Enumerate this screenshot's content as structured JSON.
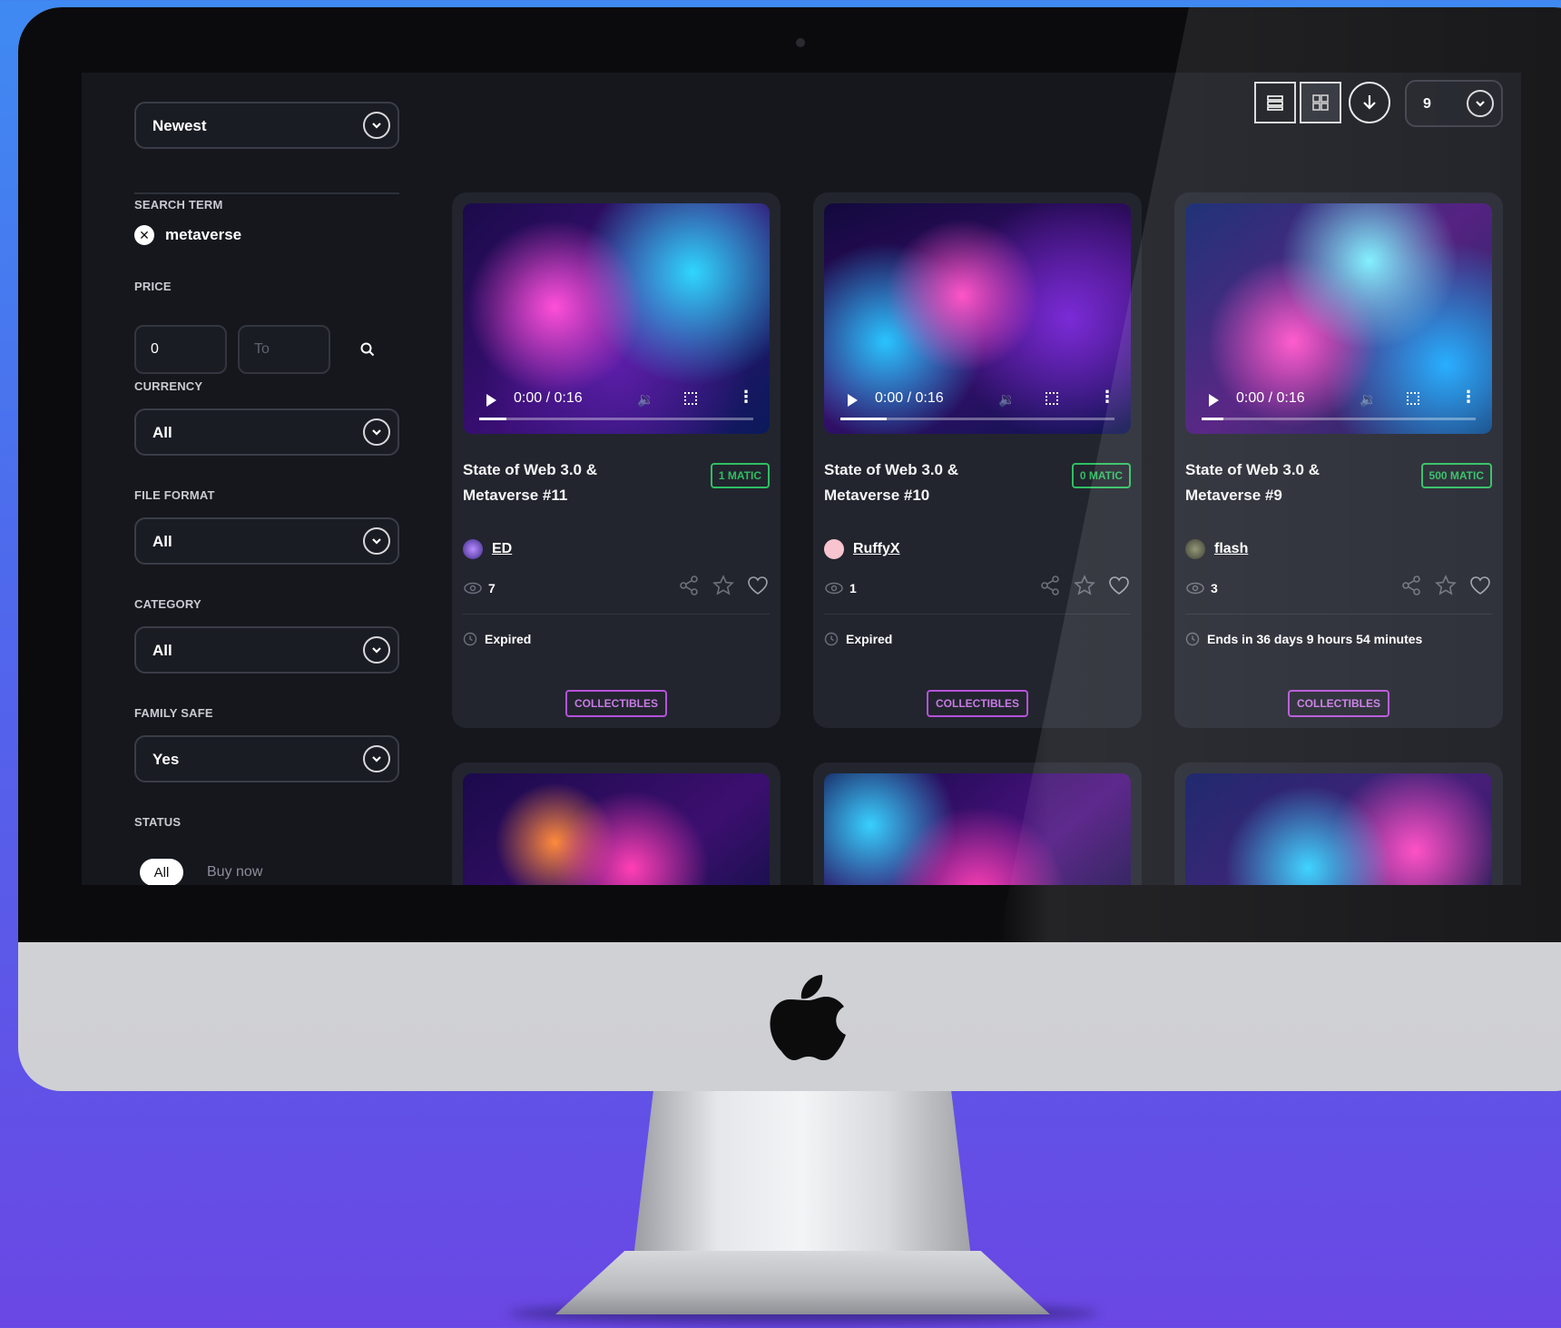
{
  "sort": {
    "value": "Newest"
  },
  "filters": {
    "search_term_label": "SEARCH TERM",
    "search_term": "metaverse",
    "price_label": "PRICE",
    "price_from": "0",
    "price_to_placeholder": "To",
    "currency_label": "CURRENCY",
    "currency_value": "All",
    "file_format_label": "FILE FORMAT",
    "file_format_value": "All",
    "category_label": "CATEGORY",
    "category_value": "All",
    "family_safe_label": "FAMILY SAFE",
    "family_safe_value": "Yes",
    "status_label": "STATUS",
    "status_options": [
      "All",
      "Buy now"
    ],
    "status_selected": "All"
  },
  "toolbar": {
    "per_page": "9"
  },
  "cards": [
    {
      "title": "State of Web 3.0 & Metaverse #11",
      "price": "1 MATIC",
      "creator": "ED",
      "views": "7",
      "time": "0:00 / 0:16",
      "progress": 0.1,
      "status": "Expired",
      "category": "COLLECTIBLES"
    },
    {
      "title": "State of Web 3.0 & Metaverse #10",
      "price": "0 MATIC",
      "creator": "RuffyX",
      "views": "1",
      "time": "0:00 / 0:16",
      "progress": 0.17,
      "status": "Expired",
      "category": "COLLECTIBLES"
    },
    {
      "title": "State of Web 3.0 & Metaverse #9",
      "price": "500 MATIC",
      "creator": "flash",
      "views": "3",
      "time": "0:00 / 0:16",
      "progress": 0.08,
      "status": "Ends in 36 days 9 hours 54 minutes",
      "category": "COLLECTIBLES"
    }
  ],
  "colors": {
    "accent_green": "#2fbf63",
    "accent_purple": "#b552d9",
    "background": "#15171d"
  }
}
